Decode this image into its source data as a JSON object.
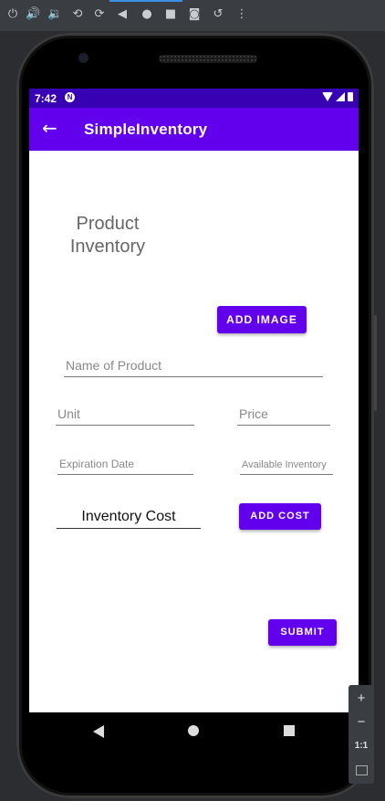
{
  "emulator": {
    "toolbar_icons": [
      "power-icon",
      "volume-up-icon",
      "volume-down-icon",
      "rotate-left-icon",
      "rotate-right-icon",
      "back-icon",
      "home-icon",
      "overview-icon",
      "screenshot-icon",
      "snapshot-icon",
      "more-icon"
    ],
    "zoom": {
      "plus": "+",
      "minus": "−",
      "ratio": "1:1"
    }
  },
  "status_bar": {
    "time": "7:42",
    "notification_icon": "N"
  },
  "app_bar": {
    "title": "SimpleInventory"
  },
  "form": {
    "heading": "Product Inventory",
    "add_image_label": "ADD IMAGE",
    "name_placeholder": "Name of Product",
    "unit_placeholder": "Unit",
    "price_placeholder": "Price",
    "expiration_placeholder": "Expiration Date",
    "available_placeholder": "Available Inventory",
    "inventory_cost_value": "Inventory Cost",
    "add_cost_label": "ADD COST",
    "submit_label": "SUBMIT"
  },
  "colors": {
    "status_bar": "#3700b3",
    "app_bar": "#6200ee",
    "button": "#6200ee"
  }
}
